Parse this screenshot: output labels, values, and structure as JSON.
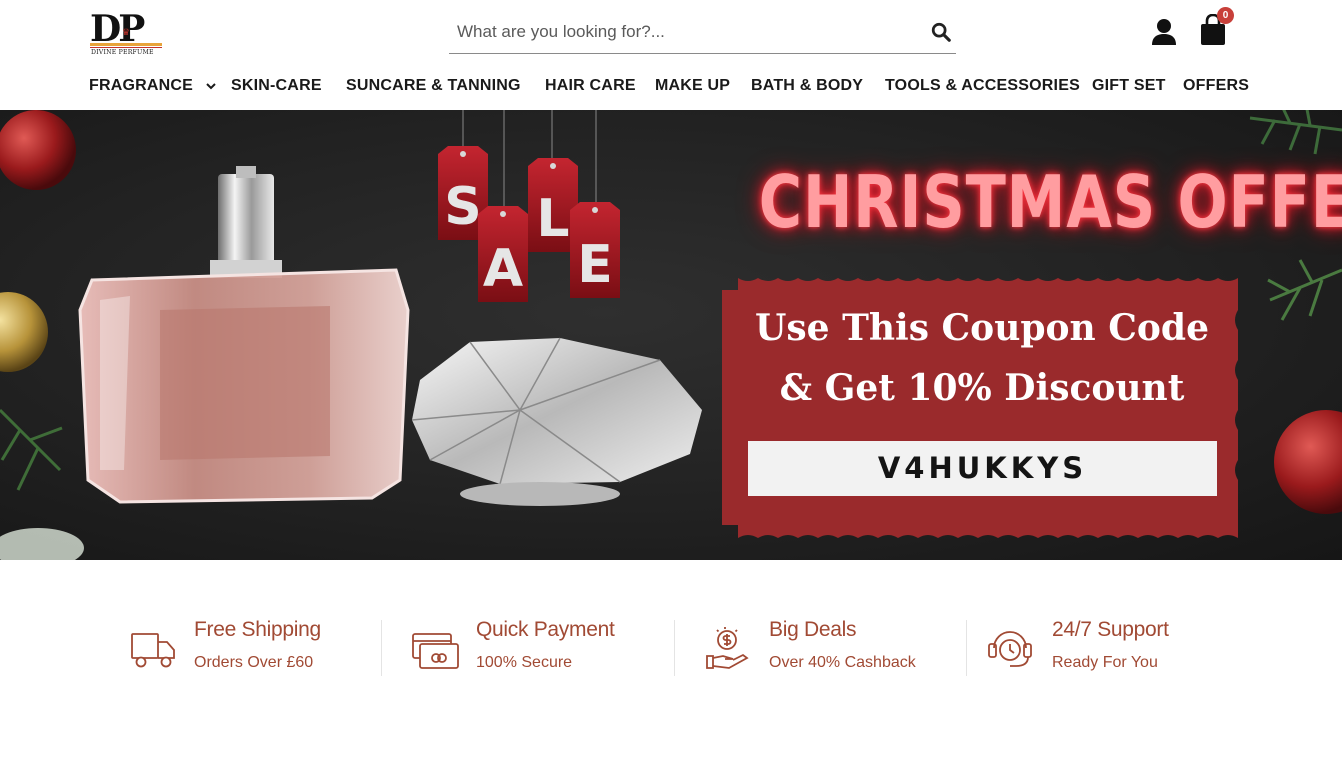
{
  "header": {
    "logo": {
      "letters": "DP",
      "subtitle": "DIVINE PERFUME"
    },
    "search": {
      "placeholder": "What are you looking for?..."
    },
    "cart": {
      "count": "0"
    }
  },
  "nav": {
    "items": [
      {
        "label": "FRAGRANCE",
        "has_dropdown": true
      },
      {
        "label": "SKIN-CARE"
      },
      {
        "label": "SUNCARE & TANNING"
      },
      {
        "label": "HAIR CARE"
      },
      {
        "label": "MAKE UP"
      },
      {
        "label": "BATH & BODY"
      },
      {
        "label": "TOOLS & ACCESSORIES"
      },
      {
        "label": "GIFT SET"
      },
      {
        "label": "OFFERS"
      }
    ]
  },
  "banner": {
    "sale_letters": [
      "S",
      "A",
      "L",
      "E"
    ],
    "title": "CHRISTMAS OFFER",
    "coupon_line1": "Use This Coupon Code",
    "coupon_line2": "& Get 10% Discount",
    "coupon_code": "V4HUKKYS"
  },
  "features": [
    {
      "icon": "truck-icon",
      "title": "Free Shipping",
      "subtitle": "Orders Over £60"
    },
    {
      "icon": "credit-card-icon",
      "title": "Quick Payment",
      "subtitle": "100% Secure"
    },
    {
      "icon": "money-hand-icon",
      "title": "Big Deals",
      "subtitle": "Over 40% Cashback"
    },
    {
      "icon": "headset-icon",
      "title": "24/7 Support",
      "subtitle": "Ready For You"
    }
  ],
  "colors": {
    "accent": "#a14a34",
    "badge": "#c8403a",
    "coupon_red": "#9a2a2c",
    "neon": "#ff9da0"
  }
}
